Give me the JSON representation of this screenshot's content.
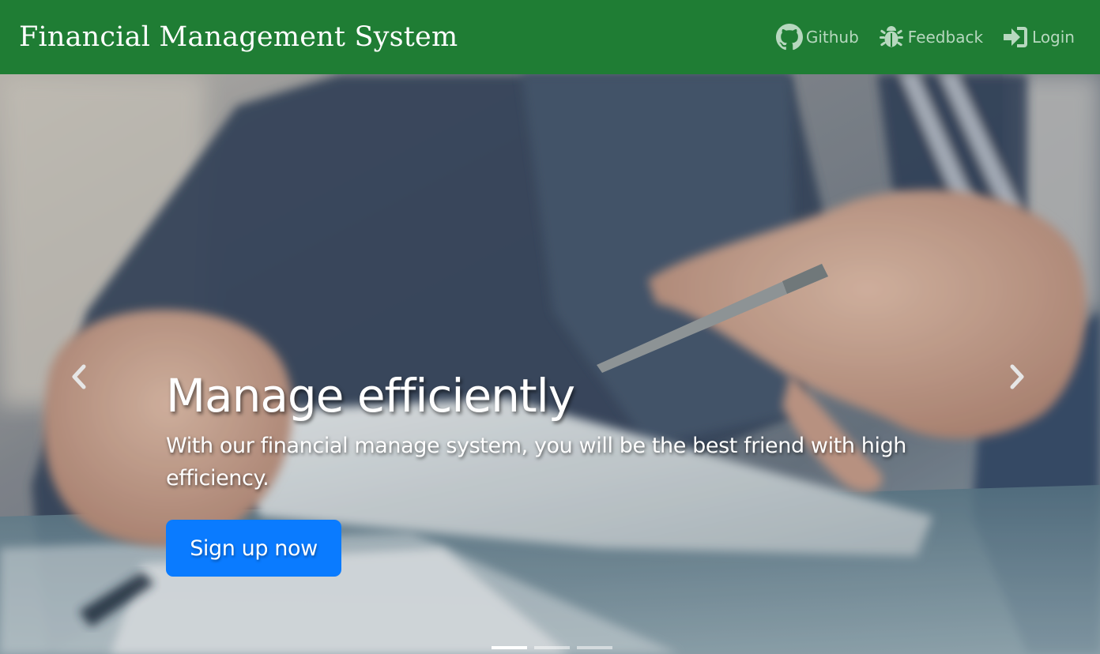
{
  "navbar": {
    "brand": "Financial Management System",
    "background": "#1f7d34",
    "links": [
      {
        "label": "Github",
        "icon": "github-icon"
      },
      {
        "label": "Feedback",
        "icon": "bug-icon"
      },
      {
        "label": "Login",
        "icon": "sign-in-icon"
      }
    ]
  },
  "hero": {
    "image": "business-people-pen-tablet-photo",
    "title": "Manage efficiently",
    "text": "With our financial manage system, you will be the best friend with high efficiency.",
    "cta_label": "Sign up now",
    "cta_color": "#0a7bff",
    "prev_icon": "chevron-left-icon",
    "next_icon": "chevron-right-icon",
    "slide_count": 3,
    "active_slide": 1
  }
}
